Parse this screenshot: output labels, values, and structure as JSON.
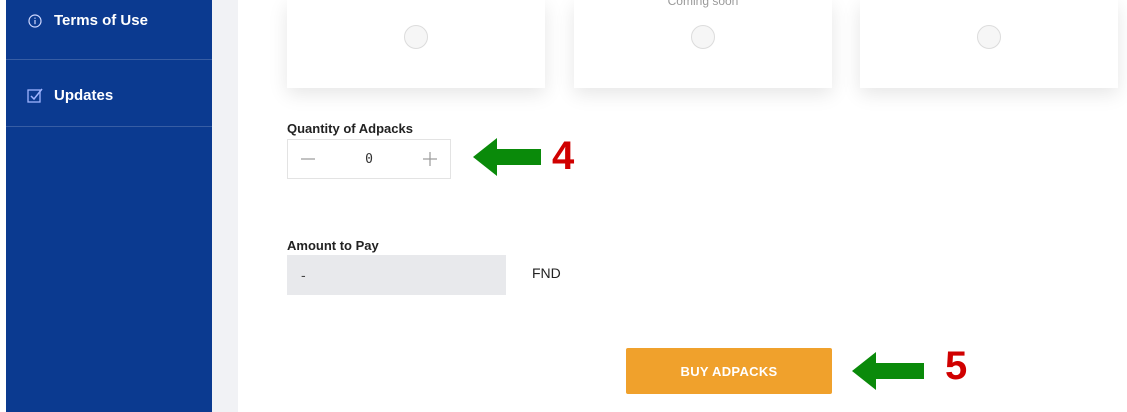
{
  "sidebar": {
    "items": [
      {
        "label": "Terms of Use",
        "icon": "info-circle-icon"
      },
      {
        "label": "Updates",
        "icon": "checkbox-icon"
      }
    ]
  },
  "packs": {
    "coming_soon_text": "Coming soon"
  },
  "form": {
    "quantity_label": "Quantity of Adpacks",
    "quantity_value": "0",
    "amount_label": "Amount to Pay",
    "amount_value": "-",
    "currency": "FND",
    "buy_label": "BUY ADPACKS"
  },
  "annotations": {
    "step_4": "4",
    "step_5": "5",
    "arrow_color": "#0a8a0a",
    "number_color": "#d00000"
  },
  "colors": {
    "sidebar_bg": "#0b3a90",
    "button_bg": "#f0a12c",
    "amount_bg": "#e8e9ec"
  }
}
